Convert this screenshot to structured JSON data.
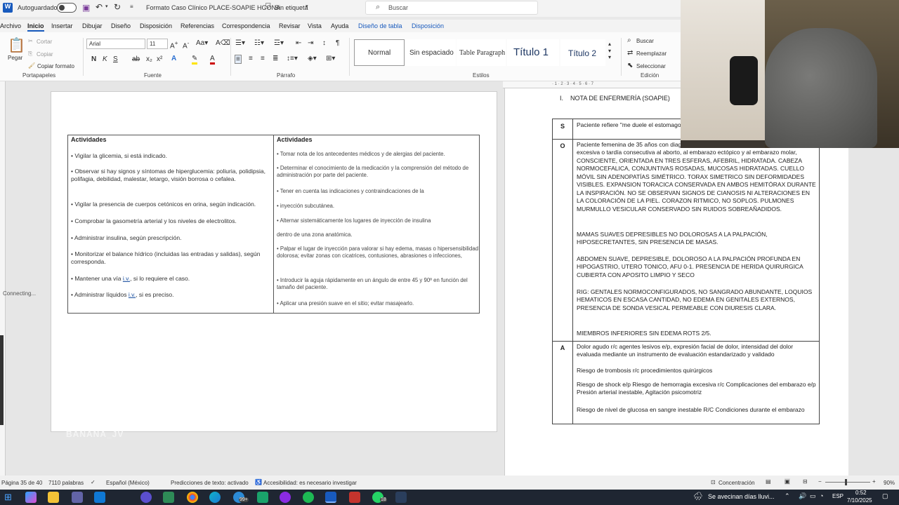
{
  "titlebar": {
    "autosave_label": "Autoguardado",
    "doc_title": "Formato Caso Clínico PLACE-SOAPIE HGONA",
    "sensitivity": "Sin etiqueta",
    "search_placeholder": "Buscar"
  },
  "menu": [
    "Archivo",
    "Inicio",
    "Insertar",
    "Dibujar",
    "Diseño",
    "Disposición",
    "Referencias",
    "Correspondencia",
    "Revisar",
    "Vista",
    "Ayuda",
    "Diseño de tabla",
    "Disposición"
  ],
  "ribbon": {
    "clipboard": {
      "paste": "Pegar",
      "cut": "Cortar",
      "copy": "Copiar",
      "format_painter": "Copiar formato",
      "group": "Portapapeles"
    },
    "font": {
      "name": "Arial",
      "size": "11",
      "group": "Fuente"
    },
    "paragraph": {
      "group": "Párrafo"
    },
    "styles": {
      "items": [
        "Normal",
        "Sin espaciado",
        "Table Paragraph",
        "Título 1",
        "Título 2"
      ],
      "group": "Estilos"
    },
    "editing": {
      "find": "Buscar",
      "replace": "Reemplazar",
      "select": "Seleccionar",
      "group": "Edición"
    }
  },
  "table1": {
    "header_left": "Actividades",
    "header_right": "Actividades",
    "left": [
      "• Vigilar la glicemia, si está indicado.",
      "• Observar si hay signos y síntomas de hiperglucemia: poliuria, polidipsia, polifagia, debilidad, malestar, letargo, visión borrosa o cefalea.",
      "• Vigilar la presencia de cuerpos cetónicos en orina, según indicación.",
      "• Comprobar la gasometría arterial y los niveles de electrolitos.",
      "• Administrar insulina, según prescripción.",
      "• Monitorizar el balance hídrico (incluidas las entradas y salidas), según corresponda.",
      "• Mantener una vía ",
      "• Administrar líquidos "
    ],
    "iv": "i.v.",
    "left_suffix_7": ", si lo requiere el caso.",
    "left_suffix_8": ", si es preciso.",
    "right": [
      "• Tomar nota de los antecedentes médicos y de alergias del paciente.",
      "• Determinar el conocimiento de la medicación y la comprensión del método de administración por parte del paciente.",
      "• Tener en cuenta las indicaciones y contraindicaciones de la",
      "• inyección subcutánea.",
      "• Alternar sistemáticamente los lugares de inyección de insulina",
      "dentro de una zona anatómica.",
      "• Palpar el lugar de inyección para valorar si hay edema, masas o hipersensibilidad dolorosa; evitar zonas con cicatrices, contusiones, abrasiones o infecciones,",
      "• Introducir la aguja rápidamente en un ángulo de entre 45 y 90º en función del tamaño del paciente.",
      "• Aplicar una presión suave en el sitio; evitar masajearlo."
    ]
  },
  "soap": {
    "heading_num": "I.",
    "heading": "NOTA DE ENFERMERÍA (SOAPIE)",
    "s_letter": "S",
    "s_text": "Paciente refiere \"me duele el estomago\"",
    "o_letter": "O",
    "o_text1": "Paciente femenina de 35 años con diagnóstico de aborto no especificado + Hemorragia excesiva o tardía consecutiva al aborto, al embarazo ectópico y al embarazo molar, CONSCIENTE, ORIENTADA EN TRES ESFERAS, AFEBRIL, HIDRATADA. CABEZA NORMOCEFALICA, CONJUNTIVAS ROSADAS, MUCOSAS HIDRATADAS. CUELLO MÓVIL SIN ADENOPATÍAS SIMÉTRICO. TORAX SIMETRICO SIN DEFORMIDADES VISIBLES. EXPANSION TORACICA CONSERVADA EN AMBOS HEMITÓRAX DURANTE LA INSPIRACIÓN. NO SE OBSERVAN SIGNOS DE CIANOSIS NI ALTERACIONES EN LA COLORACIÓN DE LA PIEL. CORAZON RITMICO, NO SOPLOS. PULMONES MURMULLO VESICULAR CONSERVADO SIN RUIDOS SOBREAÑADIDOS.",
    "o_text2": "MAMAS SUAVES DEPRESIBLES NO DOLOROSAS A LA PALPACIÓN, HIPOSECRETANTES, SIN PRESENCIA DE MASAS.",
    "o_text3": "ABDOMEN SUAVE, DEPRESIBLE, DOLOROSO A LA PALPACIÓN PROFUNDA EN HIPOGASTRIO, UTERO TONICO, AFU 0-1. PRESENCIA DE HERIDA QUIRURGICA CUBIERTA CON APOSITO LIMPIO Y SECO",
    "o_text4": "RIG: GENTALES NORMOCONFIGURADOS, NO SANGRADO ABUNDANTE, LOQUIOS HEMATICOS EN ESCASA CANTIDAD, NO EDEMA EN GENITALES EXTERNOS, PRESENCIA DE SONDA VESICAL PERMEABLE CON DIURESIS CLARA.",
    "o_text5": "MIEMBROS INFERIORES SIN EDEMA ROTS 2/5.",
    "a_letter": "A",
    "a_text1": "Dolor agudo r/c agentes lesivos e/p, expresión facial de dolor, intensidad del dolor evaluada mediante un instrumento de evaluación estandarizado y validado",
    "a_text2": "Riesgo de trombosis r/c procedimientos quirúrgicos",
    "a_text3": "Riesgo de shock e/p Riesgo de hemorragia excesiva r/c Complicaciones del embarazo e/p Presión arterial inestable,  Agitación psicomotriz",
    "a_text4": "Riesgo de nivel de glucosa en sangre inestable R/C Condiciones durante el embarazo"
  },
  "ruler_numbers": "· 1 · 2 · 3 · 4 · 5 · 6 · 7",
  "overlay": {
    "connecting": "Connecting...",
    "watermark": "BANANA_JV"
  },
  "status": {
    "page": "Página 35 de 40",
    "words": "7110 palabras",
    "language": "Español (México)",
    "predictions": "Predicciones de texto: activado",
    "accessibility": "Accesibilidad: es necesario investigar",
    "focus": "Concentración",
    "zoom": "90%"
  },
  "taskbar": {
    "weather": "Se avecinan días lluvi...",
    "lang": "ESP",
    "time": "0:52",
    "date": "7/10/2025",
    "badge_99": "99+",
    "badge_18": "18"
  },
  "colors": {
    "word_blue": "#185abd",
    "taskbar": "#1f2632"
  }
}
